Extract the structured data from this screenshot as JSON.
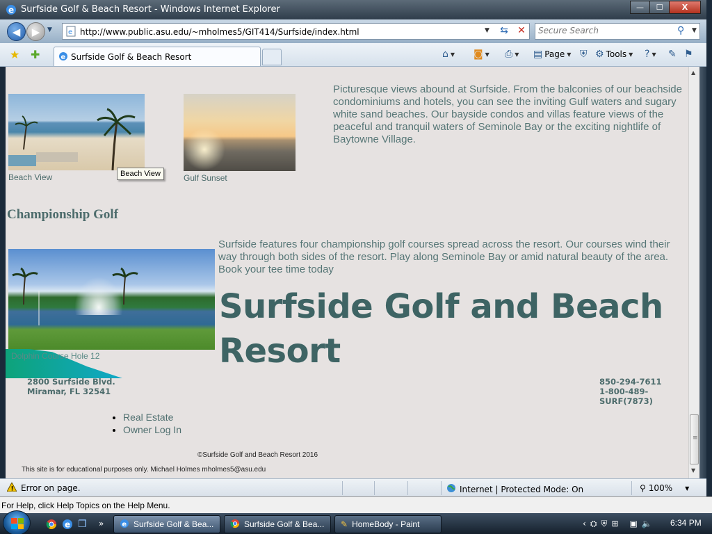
{
  "window": {
    "title": "Surfside Golf & Beach Resort - Windows Internet Explorer",
    "minimize": "—",
    "maximize": "☐",
    "close": "X"
  },
  "address_bar": {
    "url": "http://www.public.asu.edu/~mholmes5/GIT414/Surfside/index.html"
  },
  "search": {
    "placeholder": "Secure Search"
  },
  "tab": {
    "title": "Surfside Golf & Beach Resort"
  },
  "command_bar": {
    "page_label": "Page",
    "tools_label": "Tools"
  },
  "page": {
    "beach_caption": "Beach View",
    "tooltip": "Beach View",
    "sunset_caption": "Gulf Sunset",
    "intro_text": "Picturesque views abound at Surfside. From the balconies of our beachside condominiums and hotels, you can see the inviting Gulf waters and sugary white sand beaches. Our bayside condos and villas feature views of the peaceful and tranquil waters of Seminole Bay or the exciting nightlife of Baytowne Village.",
    "golf_heading": "Championship Golf",
    "golf_text": "Surfside features four championship golf courses spread across the resort. Our courses wind their way through both sides of the resort. Play along Seminole Bay or amid natural beauty of the area. Book your tee time today",
    "golf_caption": "Dolphin Course Hole 12",
    "resort_title": "Surfside Golf and Beach Resort",
    "address_line1": "2800 Surfside Blvd.",
    "address_line2": "Miramar, FL 32541",
    "phone1": "850-294-7611",
    "phone2": "1-800-489-SURF(7873)",
    "links": [
      "Real Estate",
      "Owner Log In"
    ],
    "copyright": "©Surfside Golf and Beach Resort 2016",
    "edu_note": "This site is for educational purposes only. Michael Holmes mholmes5@asu.edu"
  },
  "status_bar": {
    "message": "Error on page.",
    "zone": "Internet | Protected Mode: On",
    "zoom": "100%"
  },
  "help_bar": {
    "text": "For Help, click Help Topics on the Help Menu."
  },
  "taskbar": {
    "items": [
      "Surfside Golf & Bea...",
      "Surfside Golf & Bea...",
      "HomeBody - Paint"
    ],
    "clock": "6:34 PM"
  }
}
